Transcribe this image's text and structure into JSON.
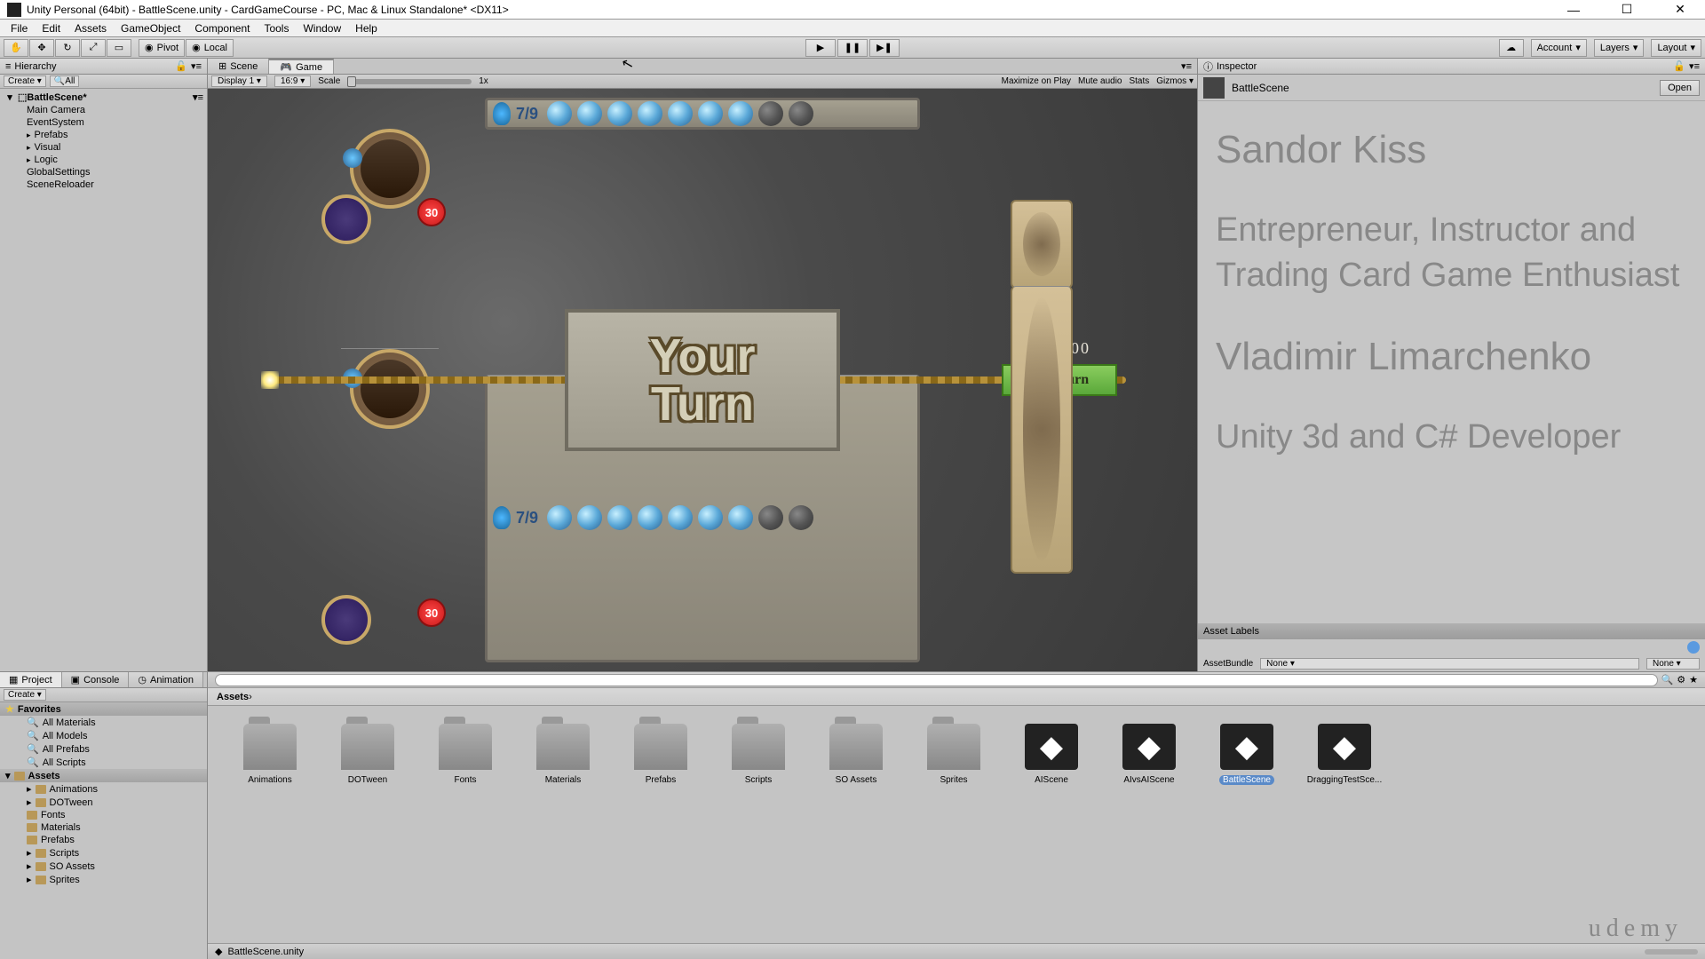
{
  "window": {
    "title": "Unity Personal (64bit) - BattleScene.unity - CardGameCourse - PC, Mac & Linux Standalone* <DX11>"
  },
  "menu": [
    "File",
    "Edit",
    "Assets",
    "GameObject",
    "Component",
    "Tools",
    "Window",
    "Help"
  ],
  "toolbar": {
    "pivot": "Pivot",
    "local": "Local",
    "account": "Account",
    "layers": "Layers",
    "layout": "Layout"
  },
  "hierarchy": {
    "tab": "Hierarchy",
    "create": "Create",
    "search": "All",
    "root": "BattleScene*",
    "items": [
      "Main Camera",
      "EventSystem",
      "Prefabs",
      "Visual",
      "Logic",
      "GlobalSettings",
      "SceneReloader"
    ]
  },
  "center": {
    "tabs": {
      "scene": "Scene",
      "game": "Game"
    },
    "display": "Display 1",
    "aspect": "16:9",
    "scale": "Scale",
    "scale_val": "1x",
    "maximize": "Maximize on Play",
    "mute": "Mute audio",
    "stats": "Stats",
    "gizmos": "Gizmos"
  },
  "game": {
    "mana": "7/9",
    "health_top": "30",
    "health_bottom": "30",
    "turn_line1": "Your",
    "turn_line2": "Turn",
    "end_turn": "End Turn",
    "timer": "00:00"
  },
  "inspector": {
    "tab": "Inspector",
    "name": "BattleScene",
    "open": "Open",
    "body_name1": "Sandor Kiss",
    "body_desc1": "Entrepreneur, Instructor and Trading Card Game Enthusiast",
    "body_name2": "Vladimir Limarchenko",
    "body_desc2": "Unity 3d and C# Developer",
    "asset_labels": "Asset Labels",
    "assetbundle": "AssetBundle",
    "bundle_none": "None",
    "bundle_none2": "None"
  },
  "project": {
    "tabs": {
      "project": "Project",
      "console": "Console",
      "animation": "Animation"
    },
    "create": "Create",
    "favorites": "Favorites",
    "fav_items": [
      "All Materials",
      "All Models",
      "All Prefabs",
      "All Scripts"
    ],
    "assets_header": "Assets",
    "asset_folders": [
      "Animations",
      "DOTween",
      "Fonts",
      "Materials",
      "Prefabs",
      "Scripts",
      "SO Assets",
      "Sprites"
    ],
    "breadcrumb": "Assets",
    "grid": [
      {
        "name": "Animations",
        "type": "folder"
      },
      {
        "name": "DOTween",
        "type": "folder"
      },
      {
        "name": "Fonts",
        "type": "folder"
      },
      {
        "name": "Materials",
        "type": "folder"
      },
      {
        "name": "Prefabs",
        "type": "folder"
      },
      {
        "name": "Scripts",
        "type": "folder"
      },
      {
        "name": "SO Assets",
        "type": "folder"
      },
      {
        "name": "Sprites",
        "type": "folder"
      },
      {
        "name": "AIScene",
        "type": "scene"
      },
      {
        "name": "AIvsAIScene",
        "type": "scene"
      },
      {
        "name": "BattleScene",
        "type": "scene",
        "selected": true
      },
      {
        "name": "DraggingTestSce...",
        "type": "scene"
      }
    ],
    "footer": "BattleScene.unity"
  },
  "watermark": "udemy"
}
